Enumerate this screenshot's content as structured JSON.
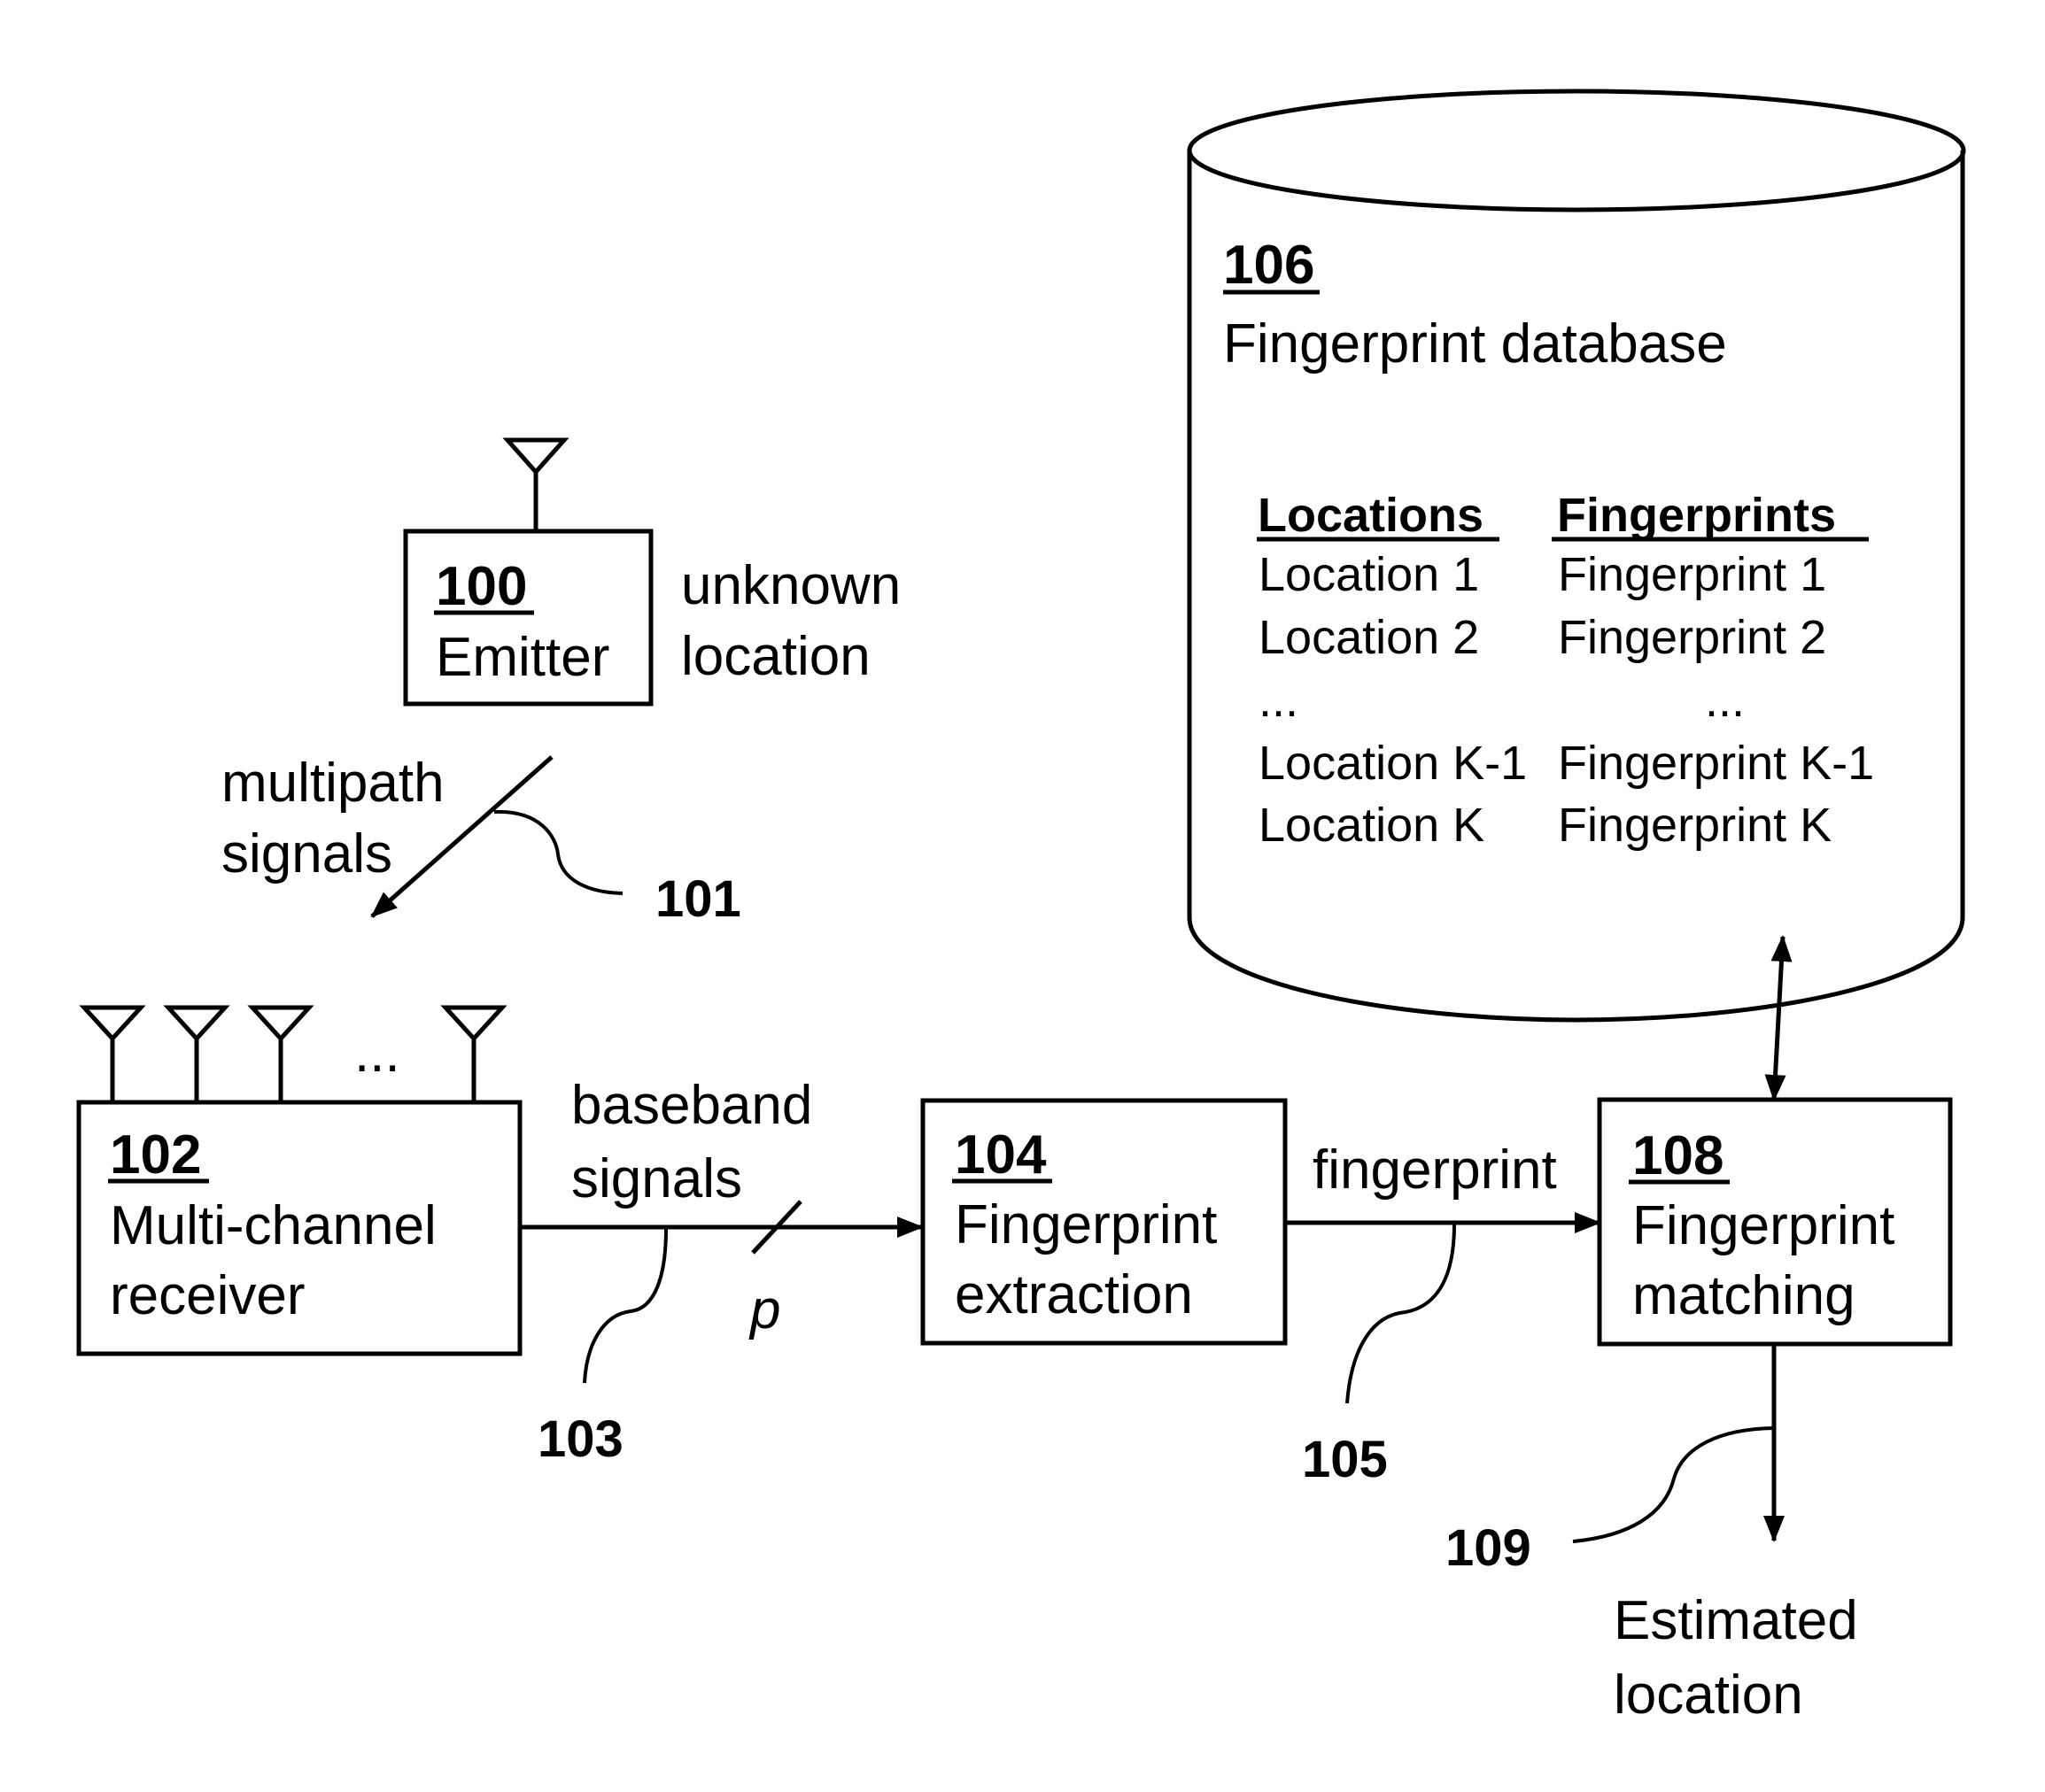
{
  "emitter": {
    "number": "100",
    "name": "Emitter",
    "side_label": [
      "unknown",
      "location"
    ]
  },
  "multipath": {
    "label": [
      "multipath",
      "signals"
    ],
    "ref": "101"
  },
  "receiver": {
    "number": "102",
    "name": [
      "Multi-channel",
      "receiver"
    ],
    "antenna_ellipsis": "..."
  },
  "baseband": {
    "label": [
      "baseband",
      "signals"
    ],
    "bus_width": "p",
    "ref": "103"
  },
  "extraction": {
    "number": "104",
    "name": [
      "Fingerprint",
      "extraction"
    ]
  },
  "fingerprint_link": {
    "label": "fingerprint",
    "ref": "105"
  },
  "database": {
    "number": "106",
    "name": "Fingerprint database",
    "columns": [
      "Locations",
      "Fingerprints"
    ],
    "rows": [
      [
        "Location 1",
        "Fingerprint 1"
      ],
      [
        "Location 2",
        "Fingerprint 2"
      ],
      [
        "...",
        "..."
      ],
      [
        "Location K-1",
        "Fingerprint K-1"
      ],
      [
        "Location K",
        "Fingerprint K"
      ]
    ]
  },
  "matching": {
    "number": "108",
    "name": [
      "Fingerprint",
      "matching"
    ]
  },
  "output": {
    "ref": "109",
    "label": [
      "Estimated",
      "location"
    ]
  }
}
